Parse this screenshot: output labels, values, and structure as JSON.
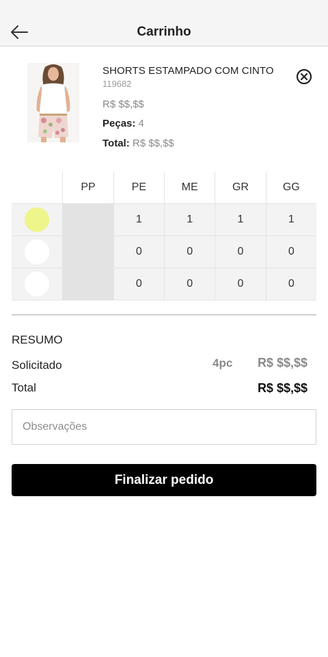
{
  "header": {
    "title": "Carrinho",
    "back_icon": "arrow-left-icon"
  },
  "product": {
    "name": "SHORTS ESTAMPADO COM CINTO",
    "code": "119682",
    "price": "R$ $$,$$",
    "pieces_label": "Peças:",
    "pieces_value": "4",
    "total_label": "Total:",
    "total_value": "R$ $$,$$",
    "remove_icon": "close-circle-icon"
  },
  "size_grid": {
    "sizes": [
      "PP",
      "PE",
      "ME",
      "GR",
      "GG"
    ],
    "rows": [
      {
        "color": "#eef58a",
        "selected": true,
        "quantities": [
          "",
          "1",
          "1",
          "1",
          "1"
        ]
      },
      {
        "color": "#ffffff",
        "selected": false,
        "quantities": [
          "",
          "0",
          "0",
          "0",
          "0"
        ]
      },
      {
        "color": "#ffffff",
        "selected": false,
        "quantities": [
          "",
          "0",
          "0",
          "0",
          "0"
        ]
      }
    ],
    "unavailable_size": "PP"
  },
  "summary": {
    "title": "RESUMO",
    "requested_label": "Solicitado",
    "requested_qty": "4pc",
    "requested_price": "R$ $$,$$",
    "total_label": "Total",
    "total_price": "R$ $$,$$"
  },
  "notes": {
    "placeholder": "Observações",
    "value": ""
  },
  "actions": {
    "submit_label": "Finalizar pedido"
  },
  "colors": {
    "accent": "#000000",
    "selected_swatch": "#eef58a",
    "muted_text": "#8a8a8a"
  }
}
